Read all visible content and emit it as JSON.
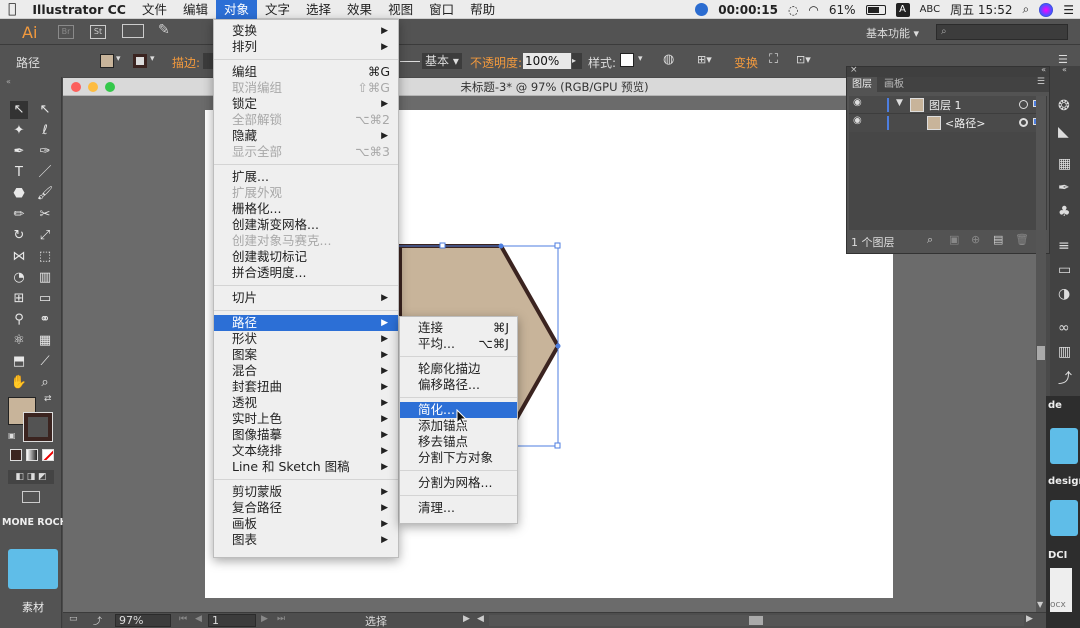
{
  "menubar": {
    "app": "Illustrator CC",
    "items": [
      "文件",
      "编辑",
      "对象",
      "文字",
      "选择",
      "效果",
      "视图",
      "窗口",
      "帮助"
    ],
    "active": "对象",
    "timer": "00:00:15",
    "battery": "61%",
    "input": "ABC",
    "clock": "周五 15:52"
  },
  "control": {
    "ai_logo": "Ai",
    "br": "Br",
    "st": "St",
    "workspace": "基本功能",
    "search_placeholder": "",
    "path_label": "路径",
    "stroke_label": "描边:",
    "basic_label": "基本",
    "opacity_label": "不透明度:",
    "opacity_value": "100%",
    "style_label": "样式:",
    "transform_label": "变换"
  },
  "document": {
    "title": "未标题-3* @ 97% (RGB/GPU 预览)"
  },
  "object_menu": {
    "items": [
      {
        "label": "变换",
        "shortcut": "",
        "submenu": true,
        "disabled": false
      },
      {
        "label": "排列",
        "shortcut": "",
        "submenu": true,
        "disabled": false
      },
      {
        "sep": true
      },
      {
        "label": "编组",
        "shortcut": "⌘G",
        "submenu": false,
        "disabled": false
      },
      {
        "label": "取消编组",
        "shortcut": "⇧⌘G",
        "submenu": false,
        "disabled": true
      },
      {
        "label": "锁定",
        "shortcut": "",
        "submenu": true,
        "disabled": false
      },
      {
        "label": "全部解锁",
        "shortcut": "⌥⌘2",
        "submenu": false,
        "disabled": true
      },
      {
        "label": "隐藏",
        "shortcut": "",
        "submenu": true,
        "disabled": false
      },
      {
        "label": "显示全部",
        "shortcut": "⌥⌘3",
        "submenu": false,
        "disabled": true
      },
      {
        "sep": true
      },
      {
        "label": "扩展...",
        "shortcut": "",
        "submenu": false,
        "disabled": false
      },
      {
        "label": "扩展外观",
        "shortcut": "",
        "submenu": false,
        "disabled": true
      },
      {
        "label": "栅格化...",
        "shortcut": "",
        "submenu": false,
        "disabled": false
      },
      {
        "label": "创建渐变网格...",
        "shortcut": "",
        "submenu": false,
        "disabled": false
      },
      {
        "label": "创建对象马赛克...",
        "shortcut": "",
        "submenu": false,
        "disabled": true
      },
      {
        "label": "创建裁切标记",
        "shortcut": "",
        "submenu": false,
        "disabled": false
      },
      {
        "label": "拼合透明度...",
        "shortcut": "",
        "submenu": false,
        "disabled": false
      },
      {
        "sep": true
      },
      {
        "label": "切片",
        "shortcut": "",
        "submenu": true,
        "disabled": false
      },
      {
        "sep": true
      },
      {
        "label": "路径",
        "shortcut": "",
        "submenu": true,
        "disabled": false,
        "highlight": true
      },
      {
        "label": "形状",
        "shortcut": "",
        "submenu": true,
        "disabled": false
      },
      {
        "label": "图案",
        "shortcut": "",
        "submenu": true,
        "disabled": false
      },
      {
        "label": "混合",
        "shortcut": "",
        "submenu": true,
        "disabled": false
      },
      {
        "label": "封套扭曲",
        "shortcut": "",
        "submenu": true,
        "disabled": false
      },
      {
        "label": "透视",
        "shortcut": "",
        "submenu": true,
        "disabled": false
      },
      {
        "label": "实时上色",
        "shortcut": "",
        "submenu": true,
        "disabled": false
      },
      {
        "label": "图像描摹",
        "shortcut": "",
        "submenu": true,
        "disabled": false
      },
      {
        "label": "文本绕排",
        "shortcut": "",
        "submenu": true,
        "disabled": false
      },
      {
        "label": "Line 和 Sketch 图稿",
        "shortcut": "",
        "submenu": true,
        "disabled": false
      },
      {
        "sep": true
      },
      {
        "label": "剪切蒙版",
        "shortcut": "",
        "submenu": true,
        "disabled": false
      },
      {
        "label": "复合路径",
        "shortcut": "",
        "submenu": true,
        "disabled": false
      },
      {
        "label": "画板",
        "shortcut": "",
        "submenu": true,
        "disabled": false
      },
      {
        "label": "图表",
        "shortcut": "",
        "submenu": true,
        "disabled": false
      }
    ]
  },
  "path_menu": {
    "items": [
      {
        "label": "连接",
        "shortcut": "⌘J"
      },
      {
        "label": "平均...",
        "shortcut": "⌥⌘J"
      },
      {
        "sep": true
      },
      {
        "label": "轮廓化描边",
        "shortcut": ""
      },
      {
        "label": "偏移路径...",
        "shortcut": ""
      },
      {
        "sep": true
      },
      {
        "label": "简化...",
        "shortcut": "",
        "highlight": true
      },
      {
        "label": "添加锚点",
        "shortcut": ""
      },
      {
        "label": "移去锚点",
        "shortcut": ""
      },
      {
        "label": "分割下方对象",
        "shortcut": ""
      },
      {
        "sep": true
      },
      {
        "label": "分割为网格...",
        "shortcut": ""
      },
      {
        "sep": true
      },
      {
        "label": "清理...",
        "shortcut": ""
      }
    ]
  },
  "layers_panel": {
    "tab_layers": "图层",
    "tab_artboards": "画板",
    "layer_name": "图层 1",
    "sublayer_name": "<路径>",
    "count": "1 个图层"
  },
  "desktop": {
    "label_top": "MONE ROCH",
    "folder": "素材",
    "right_labels": [
      "de",
      "design",
      "DCI",
      "ocx"
    ]
  },
  "status": {
    "zoom": "97%",
    "page": "1",
    "tool": "选择"
  },
  "colors": {
    "accent": "#2c6fd6",
    "fill": "#c8b49a",
    "stroke": "#3b2420"
  }
}
